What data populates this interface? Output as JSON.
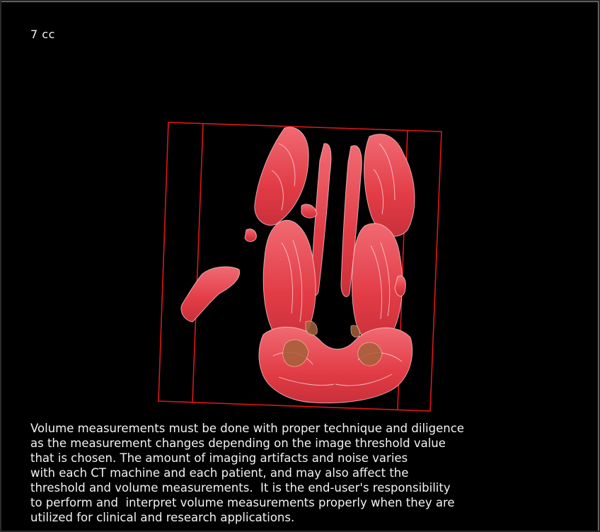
{
  "viewer": {
    "volume_readout": "7 cc",
    "disclaimer_lines": [
      "Volume measurements must be done with proper technique and diligence",
      "as the measurement changes depending on the image threshold value",
      "that is chosen. The amount of imaging artifacts and noise varies",
      "with each CT machine and each patient, and may also affect the",
      "threshold and volume measurements.  It is the end-user's responsibility",
      "to perform and  interpret volume measurements properly when they are",
      "utilized for clinical and research applications."
    ],
    "colors": {
      "background": "#000000",
      "bounding_box": "#e0161b",
      "rendering": "#e8404a",
      "highlight": "#ffd0d4",
      "text": "#f2f2f2"
    }
  }
}
